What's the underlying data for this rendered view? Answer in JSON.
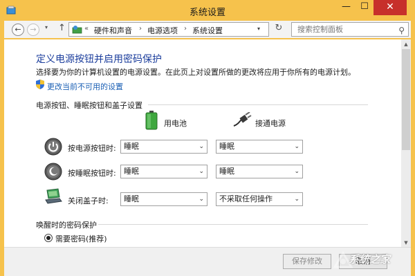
{
  "window": {
    "title": "系统设置",
    "minimize_glyph": "—",
    "maximize_glyph": "☐",
    "close_glyph": "✕"
  },
  "nav": {
    "back_glyph": "←",
    "forward_glyph": "→",
    "dropdown_glyph": "▾",
    "up_glyph": "↑",
    "overflow": "«",
    "breadcrumbs": [
      "硬件和声音",
      "电源选项",
      "系统设置"
    ],
    "separator": "›",
    "refresh_glyph": "↻",
    "search_placeholder": "搜索控制面板",
    "search_glyph": "⚲"
  },
  "main": {
    "heading": "定义电源按钮并启用密码保护",
    "description": "选择要为你的计算机设置的电源设置。在此页上对设置所做的更改将应用于你所有的电源计划。",
    "change_link": "更改当前不可用的设置",
    "section_buttons": "电源按钮、睡眠按钮和盖子设置",
    "col_battery": "用电池",
    "col_plugged": "接通电源",
    "rows": [
      {
        "label": "按电源按钮时:",
        "battery": "睡眠",
        "plugged": "睡眠"
      },
      {
        "label": "按睡眠按钮时:",
        "battery": "睡眠",
        "plugged": "睡眠"
      },
      {
        "label": "关闭盖子时:",
        "battery": "睡眠",
        "plugged": "不采取任何操作"
      }
    ],
    "section_password": "唤醒时的密码保护",
    "radio_require": "需要密码(推荐)"
  },
  "footer": {
    "save": "保存修改",
    "cancel": "取消"
  },
  "watermark": "系统之家",
  "colors": {
    "frame": "#f6c24c",
    "close": "#c7302b",
    "heading": "#1b3d9c",
    "link": "#1a5fb4"
  }
}
